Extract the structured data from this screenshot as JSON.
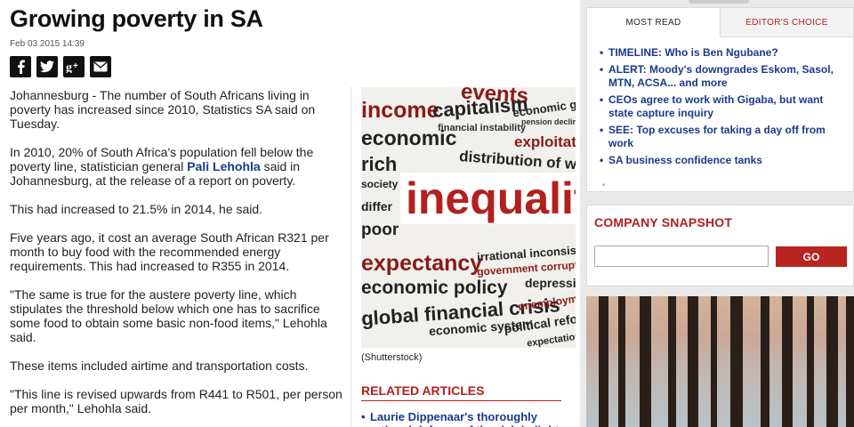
{
  "article": {
    "headline": "Growing poverty in SA",
    "date": "Feb 03 2015 14:39",
    "share_icons": [
      "facebook-icon",
      "twitter-icon",
      "google-plus-icon",
      "email-icon"
    ],
    "paragraphs": [
      {
        "text": "Johannesburg - The number of South Africans living in poverty has increased since 2010, Statistics SA said on Tuesday."
      },
      {
        "before": "In 2010, 20% of South Africa's population fell below the poverty line, statistician general ",
        "link": "Pali Lehohla",
        "after": " said in Johannesburg, at the release of a report on poverty."
      },
      {
        "text": "This had increased to 21.5% in 2014, he said."
      },
      {
        "text": "Five years ago, it cost an average South African R321 per month to buy food with the recommended energy requirements. This had increased to R355 in 2014."
      },
      {
        "text": "\"The same is true for the austere poverty line, which stipulates the threshold below which one has to sacrifice some food to obtain some basic non-food items,\" Lehohla said."
      },
      {
        "text": "These items included airtime and transportation costs."
      },
      {
        "text": "\"This line is revised upwards from R441 to R501, per person per month,\" Lehohla said."
      }
    ]
  },
  "image": {
    "caption": "(Shutterstock)",
    "words": {
      "w1": "income",
      "w2": "capitalism",
      "w3": "economic growth",
      "w4": "economic",
      "w5": "distribution of wealth",
      "w6": "exploitation",
      "w7": "rich",
      "w8": "society",
      "w9": "inequality",
      "w10": "differ",
      "w11": "poor",
      "w12": "expectancy",
      "w13": "irrational inconsistencies",
      "w14": "government corruption",
      "w15": "economic policy",
      "w16": "global financial crisis",
      "w17": "depression",
      "w18": "unemployment",
      "w19": "economic system",
      "w20": "political reforms",
      "w21": "expectations",
      "w22": "financial instability",
      "w23": "events",
      "w24": "pension decline"
    }
  },
  "related": {
    "title": "RELATED ARTICLES",
    "items": [
      "Laurie Dippenaar's thoroughly rational defence of the rich in light"
    ]
  },
  "sidebar": {
    "tabs": [
      {
        "label": "MOST READ"
      },
      {
        "label": "EDITOR'S CHOICE"
      }
    ],
    "most_read": [
      "TIMELINE: Who is Ben Ngubane?",
      "ALERT: Moody's downgrades Eskom, Sasol, MTN, ACSA... and more",
      "CEOs agree to work with Gigaba, but want state capture inquiry",
      "SEE: Top excuses for taking a day off from work",
      "SA business confidence tanks"
    ],
    "dot": "*",
    "snapshot": {
      "title": "COMPANY SNAPSHOT",
      "input_value": "",
      "button": "GO"
    }
  },
  "colors": {
    "accent_red": "#b3201d",
    "link_blue": "#1a3a8c"
  }
}
